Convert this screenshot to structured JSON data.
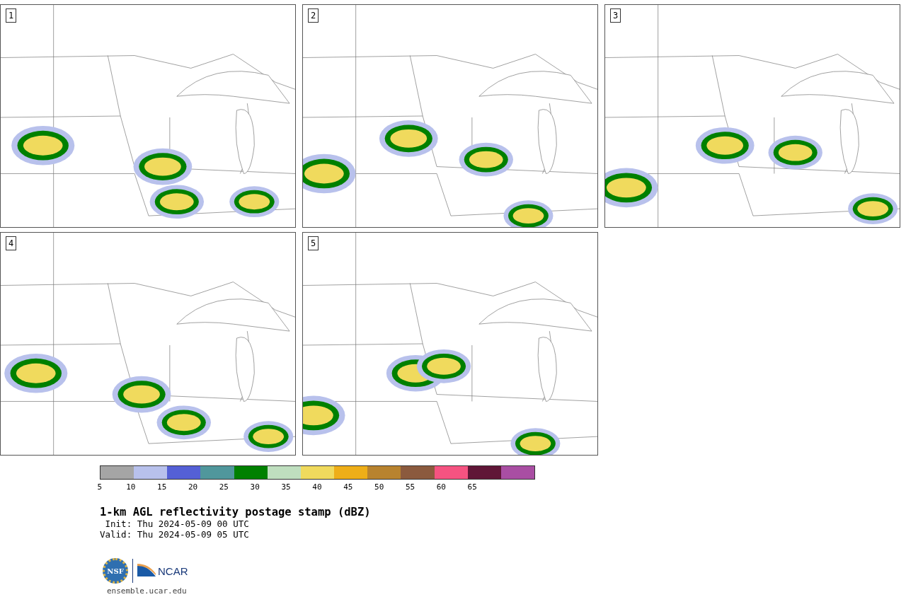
{
  "panels": [
    {
      "label": "1"
    },
    {
      "label": "2"
    },
    {
      "label": "3"
    },
    {
      "label": "4"
    },
    {
      "label": "5"
    }
  ],
  "colorbar": {
    "segments": [
      {
        "color": "#a5a5a5"
      },
      {
        "color": "#b8c1ec"
      },
      {
        "color": "#5460d6"
      },
      {
        "color": "#50979c"
      },
      {
        "color": "#008000"
      },
      {
        "color": "#bfdfbf"
      },
      {
        "color": "#f0da5d"
      },
      {
        "color": "#eeae18"
      },
      {
        "color": "#b8832f"
      },
      {
        "color": "#8b5a3e"
      },
      {
        "color": "#f55381"
      },
      {
        "color": "#601637"
      },
      {
        "color": "#a94ea3"
      }
    ],
    "ticks": [
      "5",
      "10",
      "15",
      "20",
      "25",
      "30",
      "35",
      "40",
      "45",
      "50",
      "55",
      "60",
      "65"
    ]
  },
  "title": "1-km AGL reflectivity postage stamp (dBZ)",
  "init": " Init: Thu 2024-05-09 00 UTC",
  "valid": "Valid: Thu 2024-05-09 05 UTC",
  "logos": {
    "left": "NSF",
    "right": "NCAR"
  },
  "url": "ensemble.ucar.edu"
}
